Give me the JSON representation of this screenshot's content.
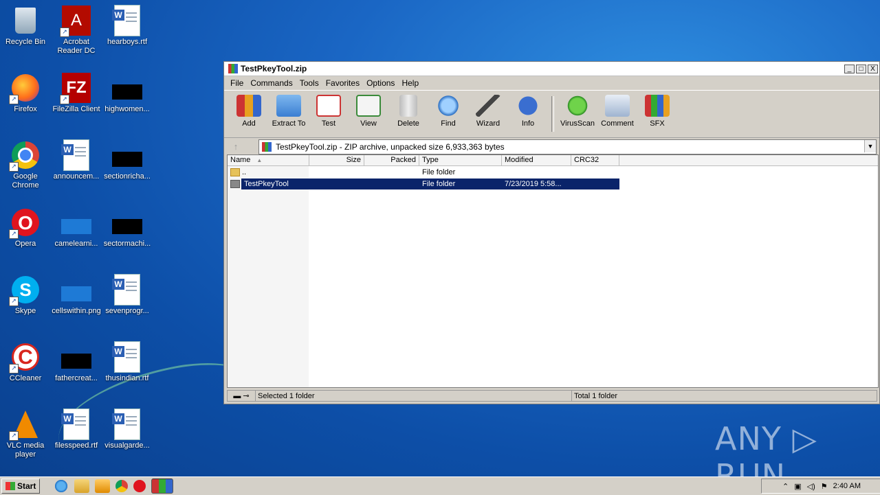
{
  "desktop": {
    "icons": [
      {
        "label": "Recycle Bin"
      },
      {
        "label": "Acrobat Reader DC"
      },
      {
        "label": "hearboys.rtf"
      },
      {
        "label": "Firefox"
      },
      {
        "label": "FileZilla Client"
      },
      {
        "label": "highwomen..."
      },
      {
        "label": "Google Chrome"
      },
      {
        "label": "announcem..."
      },
      {
        "label": "sectionricha..."
      },
      {
        "label": "Opera"
      },
      {
        "label": "camelearni..."
      },
      {
        "label": "sectormachi..."
      },
      {
        "label": "Skype"
      },
      {
        "label": "cellswithin.png"
      },
      {
        "label": "sevenprogr..."
      },
      {
        "label": "CCleaner"
      },
      {
        "label": "fathercreat..."
      },
      {
        "label": "thusindian.rtf"
      },
      {
        "label": "VLC media player"
      },
      {
        "label": "filesspeed.rtf"
      },
      {
        "label": "visualgarde..."
      }
    ]
  },
  "window": {
    "title": "TestPkeyTool.zip",
    "controls": {
      "minimize": "_",
      "maximize": "□",
      "close": "X"
    },
    "menu": [
      "File",
      "Commands",
      "Tools",
      "Favorites",
      "Options",
      "Help"
    ],
    "toolbar": [
      {
        "label": "Add",
        "icon": "add-icon"
      },
      {
        "label": "Extract To",
        "icon": "extract-icon"
      },
      {
        "label": "Test",
        "icon": "test-icon"
      },
      {
        "label": "View",
        "icon": "view-icon"
      },
      {
        "label": "Delete",
        "icon": "delete-icon"
      },
      {
        "label": "Find",
        "icon": "find-icon"
      },
      {
        "label": "Wizard",
        "icon": "wizard-icon"
      },
      {
        "label": "Info",
        "icon": "info-icon"
      },
      {
        "label": "VirusScan",
        "icon": "virusscan-icon"
      },
      {
        "label": "Comment",
        "icon": "comment-icon"
      },
      {
        "label": "SFX",
        "icon": "sfx-icon"
      }
    ],
    "address": "TestPkeyTool.zip - ZIP archive, unpacked size 6,933,363 bytes",
    "columns": [
      "Name",
      "Size",
      "Packed",
      "Type",
      "Modified",
      "CRC32"
    ],
    "rows": [
      {
        "name": "..",
        "size": "",
        "packed": "",
        "type": "File folder",
        "modified": "",
        "crc": ""
      },
      {
        "name": "TestPkeyTool",
        "size": "",
        "packed": "",
        "type": "File folder",
        "modified": "7/23/2019 5:58...",
        "crc": ""
      }
    ],
    "status": {
      "left": "Selected 1 folder",
      "right": "Total 1 folder"
    }
  },
  "taskbar": {
    "start_label": "Start",
    "clock": "2:40 AM"
  },
  "watermark": "ANY ▷ RUN"
}
